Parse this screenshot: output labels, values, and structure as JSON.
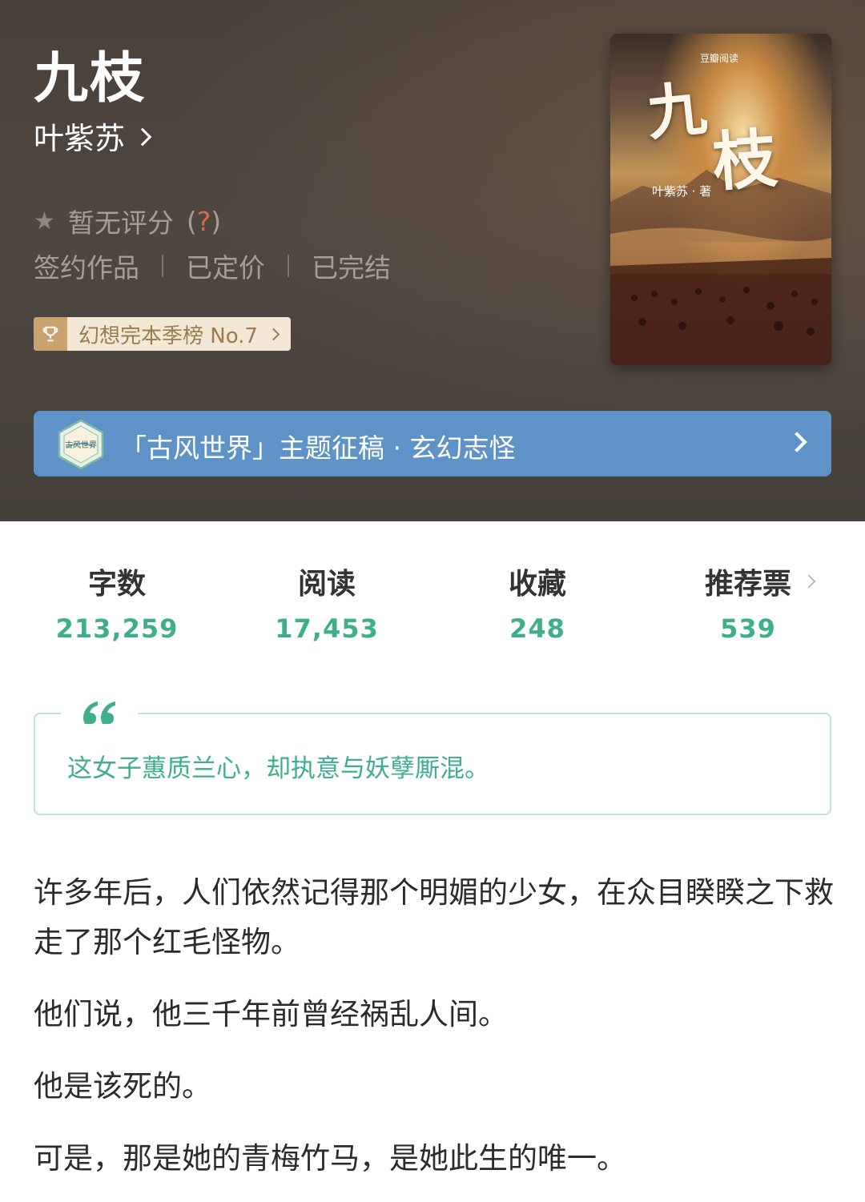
{
  "book": {
    "title": "九枝",
    "author": "叶紫苏",
    "rating": "暂无评分",
    "rating_help_open": "(",
    "rating_help_mark": "?",
    "rating_help_close": ")",
    "tags": [
      "签约作品",
      "已定价",
      "已完结"
    ],
    "rank": "幻想完本季榜 No.7",
    "cover": {
      "brand": "豆瓣阅读",
      "title_char1": "九",
      "title_char2": "枝",
      "author_credit": "叶紫苏 · 著"
    }
  },
  "banner": {
    "text": "「古风世界」主题征稿 · 玄幻志怪",
    "icon_label": "古风世界"
  },
  "stats": [
    {
      "label": "字数",
      "value": "213,259"
    },
    {
      "label": "阅读",
      "value": "17,453"
    },
    {
      "label": "收藏",
      "value": "248"
    },
    {
      "label": "推荐票",
      "value": "539"
    }
  ],
  "quote": "这女子蕙质兰心，却执意与妖孽厮混。",
  "description": [
    "许多年后，人们依然记得那个明媚的少女，在众目睽睽之下救走了那个红毛怪物。",
    "他们说，他三千年前曾经祸乱人间。",
    "他是该死的。",
    "可是，那是她的青梅竹马，是她此生的唯一。"
  ],
  "colors": {
    "accent_green": "#3fae8d",
    "banner_blue": "#5f93c7",
    "rank_gold": "#c9a36f"
  }
}
